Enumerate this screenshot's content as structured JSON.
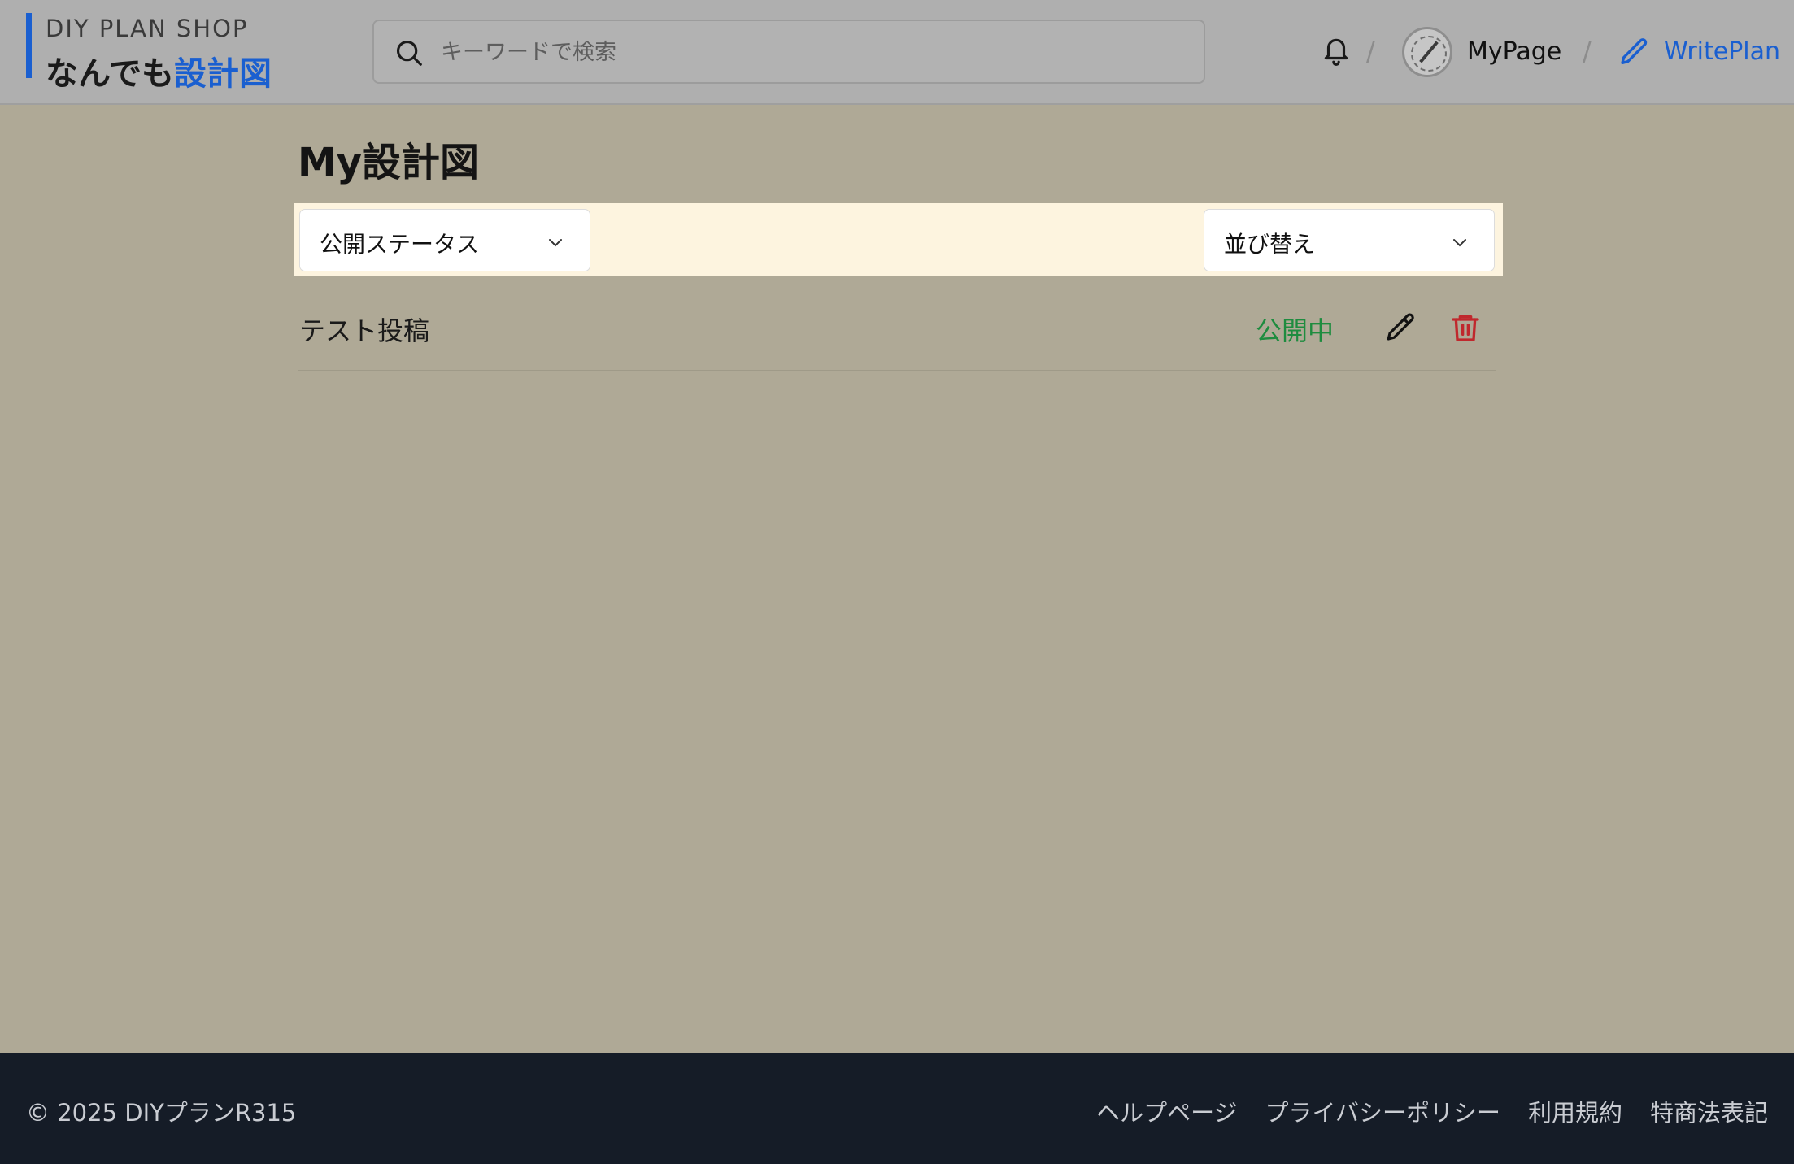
{
  "header": {
    "logo_sub": "DIY PLAN SHOP",
    "logo_main_prefix": "なんでも",
    "logo_main_accent": "設計図",
    "search_placeholder": "キーワードで検索",
    "separator": "/",
    "mypage_label": "MyPage",
    "writeplan_label": "WritePlan"
  },
  "main": {
    "title": "My設計図",
    "filters": {
      "status_label": "公開ステータス",
      "sort_label": "並び替え"
    },
    "posts": [
      {
        "title": "テスト投稿",
        "status": "公開中"
      }
    ]
  },
  "footer": {
    "copyright": "© 2025 DIYプランR315",
    "links": [
      "ヘルプページ",
      "プライバシーポリシー",
      "利用規約",
      "特商法表記"
    ]
  },
  "colors": {
    "accent": "#1a5fd0",
    "status_public": "#1e8c3f",
    "delete": "#c0282d",
    "footer_bg": "#151c27"
  }
}
